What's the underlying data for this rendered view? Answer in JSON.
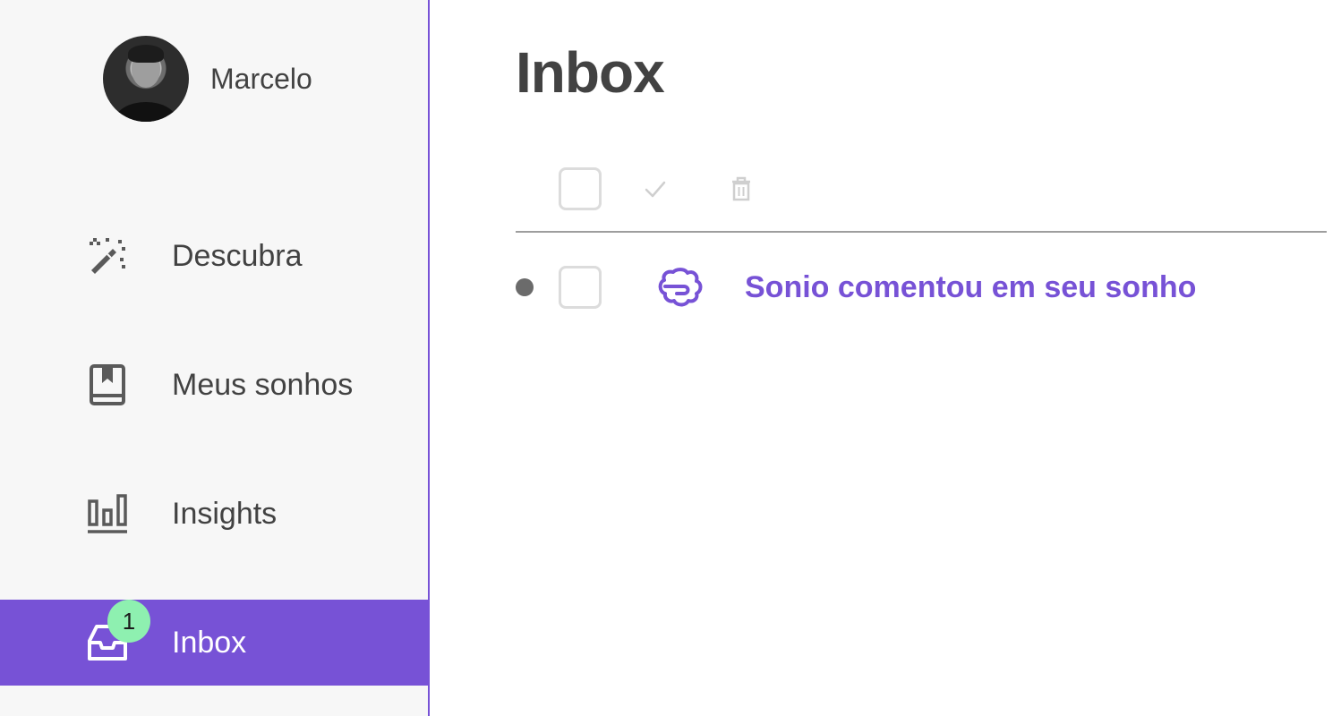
{
  "user": {
    "name": "Marcelo"
  },
  "sidebar": {
    "items": [
      {
        "label": "Descubra",
        "icon": "magic-wand-icon"
      },
      {
        "label": "Meus sonhos",
        "icon": "bookmark-book-icon"
      },
      {
        "label": "Insights",
        "icon": "bar-chart-icon"
      },
      {
        "label": "Inbox",
        "icon": "inbox-tray-icon",
        "badge": "1",
        "active": true
      }
    ]
  },
  "main": {
    "title": "Inbox",
    "messages": [
      {
        "text": "Sonio comentou em seu sonho",
        "icon": "brain-icon",
        "unread": true
      }
    ]
  },
  "colors": {
    "accent": "#7752d6",
    "badge": "#8ef0b0",
    "text": "#424242",
    "sidebar_bg": "#f7f7f7"
  }
}
